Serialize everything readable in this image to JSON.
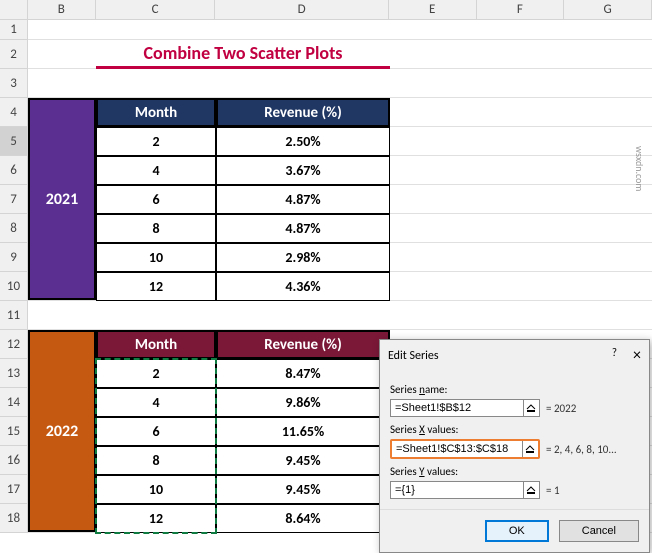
{
  "columns": [
    "A",
    "B",
    "C",
    "D",
    "E",
    "F",
    "G"
  ],
  "rows": [
    "1",
    "2",
    "3",
    "4",
    "5",
    "6",
    "7",
    "8",
    "9",
    "10",
    "11",
    "12",
    "13",
    "14",
    "15",
    "16",
    "17",
    "18"
  ],
  "title": "Combine Two Scatter Plots",
  "table1": {
    "year": "2021",
    "headers": {
      "month": "Month",
      "revenue": "Revenue (%)"
    },
    "rows": [
      {
        "month": "2",
        "revenue": "2.50%"
      },
      {
        "month": "4",
        "revenue": "3.67%"
      },
      {
        "month": "6",
        "revenue": "4.87%"
      },
      {
        "month": "8",
        "revenue": "4.87%"
      },
      {
        "month": "10",
        "revenue": "2.98%"
      },
      {
        "month": "12",
        "revenue": "4.36%"
      }
    ]
  },
  "table2": {
    "year": "2022",
    "headers": {
      "month": "Month",
      "revenue": "Revenue (%)"
    },
    "rows": [
      {
        "month": "2",
        "revenue": "8.47%"
      },
      {
        "month": "4",
        "revenue": "9.86%"
      },
      {
        "month": "6",
        "revenue": "11.65%"
      },
      {
        "month": "8",
        "revenue": "9.45%"
      },
      {
        "month": "10",
        "revenue": "9.45%"
      },
      {
        "month": "12",
        "revenue": "8.64%"
      }
    ]
  },
  "dialog": {
    "title": "Edit Series",
    "help": "?",
    "close": "×",
    "name_label_pre": "Series ",
    "name_label_u": "n",
    "name_label_post": "ame:",
    "name_value": "=Sheet1!$B$12",
    "name_hint": "= 2022",
    "x_label_pre": "Series ",
    "x_label_u": "X",
    "x_label_post": " values:",
    "x_value": "=Sheet1!$C$13:$C$18",
    "x_hint": "= 2, 4, 6, 8, 10...",
    "y_label_pre": "Series ",
    "y_label_u": "Y",
    "y_label_post": " values:",
    "y_value": "={1}",
    "y_hint": "= 1",
    "ok": "OK",
    "cancel": "Cancel"
  },
  "watermark": "wsxdn.com",
  "chart_data": {
    "type": "scatter",
    "title": "Combine Two Scatter Plots",
    "xlabel": "Month",
    "ylabel": "Revenue (%)",
    "series": [
      {
        "name": "2021",
        "x": [
          2,
          4,
          6,
          8,
          10,
          12
        ],
        "y": [
          2.5,
          3.67,
          4.87,
          4.87,
          2.98,
          4.36
        ]
      },
      {
        "name": "2022",
        "x": [
          2,
          4,
          6,
          8,
          10,
          12
        ],
        "y": [
          8.47,
          9.86,
          11.65,
          9.45,
          9.45,
          8.64
        ]
      }
    ]
  }
}
